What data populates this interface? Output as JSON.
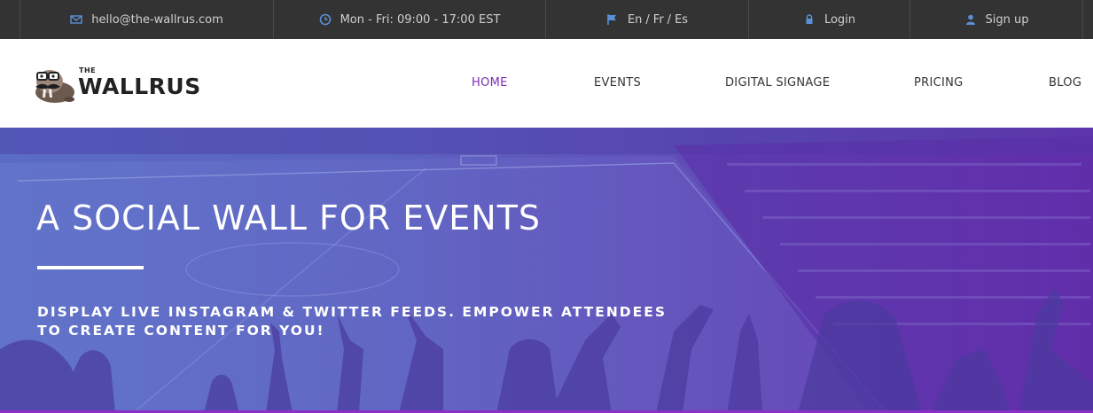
{
  "topbar": {
    "email": "hello@the-wallrus.com",
    "hours": "Mon - Fri: 09:00 - 17:00 EST",
    "languages": [
      "En",
      "Fr",
      "Es"
    ],
    "login": "Login",
    "signup": "Sign up",
    "icons": [
      "envelope-icon",
      "clock-icon",
      "flag-icon",
      "lock-icon",
      "user-icon"
    ],
    "icon_color": "#5b8fd8"
  },
  "header": {
    "logo_small": "THE",
    "logo_big": "WALLRUS",
    "nav": [
      "HOME",
      "EVENTS",
      "DIGITAL SIGNAGE",
      "PRICING",
      "BLOG"
    ],
    "active_nav": "HOME",
    "active_color": "#7b2db6"
  },
  "hero": {
    "title": "A SOCIAL WALL FOR EVENTS",
    "subtitle_line1": "DISPLAY LIVE INSTAGRAM & TWITTER FEEDS. EMPOWER ATTENDEES",
    "subtitle_line2": "TO CREATE CONTENT FOR YOU!"
  }
}
